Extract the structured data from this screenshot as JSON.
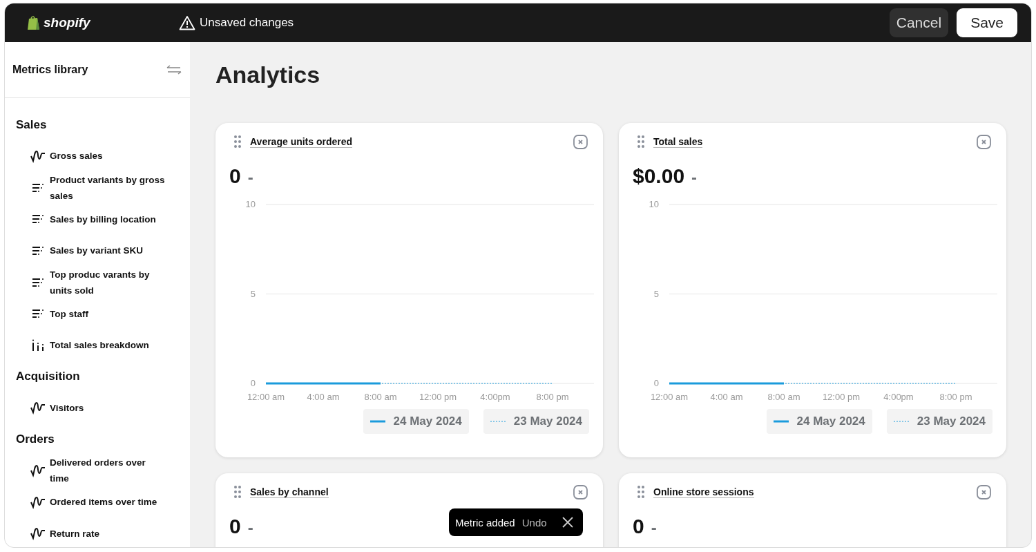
{
  "top_bar": {
    "logo": "shopify",
    "status": "Unsaved changes",
    "buttons": [
      {
        "label": "Cancel",
        "kind": "secondary"
      },
      {
        "label": "Save",
        "kind": "primary"
      }
    ]
  },
  "sidebar": {
    "title": "Metrics library",
    "sections": [
      {
        "title": "Sales",
        "items": [
          {
            "label": "Gross sales",
            "kind": "line"
          },
          {
            "label": "Product variants by gross sales",
            "kind": "bar"
          },
          {
            "label": "Sales by billing location",
            "kind": "bar"
          },
          {
            "label": "Sales by variant SKU",
            "kind": "bar"
          },
          {
            "label": "Top produc varants by units sold",
            "kind": "bar"
          },
          {
            "label": "Top staff",
            "kind": "bar"
          },
          {
            "label": "Total sales breakdown",
            "kind": "column"
          }
        ]
      },
      {
        "title": "Acquisition",
        "items": [
          {
            "label": "Visitors",
            "kind": "line"
          }
        ]
      },
      {
        "title": "Orders",
        "items": [
          {
            "label": "Delivered orders over time",
            "kind": "line"
          },
          {
            "label": "Ordered items over time",
            "kind": "line"
          },
          {
            "label": "Return rate",
            "kind": "line"
          }
        ]
      }
    ]
  },
  "page_title": "Analytics",
  "cards": [
    {
      "title": "Average units ordered",
      "value": "0",
      "change": "-",
      "chart_data": {
        "type": "line",
        "categories": [
          "12:00 am",
          "4:00 am",
          "8:00 am",
          "12:00 pm",
          "4:00pm",
          "8:00 pm"
        ],
        "yticks": [
          0,
          5,
          10
        ],
        "ylim": [
          0,
          10
        ],
        "series": [
          {
            "name": "24 May 2024",
            "color": "#1a9bdc",
            "line_style": "solid",
            "values": [
              0,
              0,
              0,
              null,
              null,
              null
            ]
          },
          {
            "name": "23 May 2024",
            "color": "#1a9bdc",
            "line_style": "dotted",
            "values": [
              0,
              0,
              0,
              0,
              0,
              0
            ]
          }
        ]
      }
    },
    {
      "title": "Total sales",
      "value": "$0.00",
      "change": "-",
      "chart_data": {
        "type": "line",
        "categories": [
          "12:00 am",
          "4:00 am",
          "8:00 am",
          "12:00 pm",
          "4:00pm",
          "8:00 pm"
        ],
        "yticks": [
          0,
          5,
          10
        ],
        "ylim": [
          0,
          10
        ],
        "series": [
          {
            "name": "24 May 2024",
            "color": "#1a9bdc",
            "line_style": "solid",
            "values": [
              0,
              0,
              0,
              null,
              null,
              null
            ]
          },
          {
            "name": "23 May 2024",
            "color": "#1a9bdc",
            "line_style": "dotted",
            "values": [
              0,
              0,
              0,
              0,
              0,
              0
            ]
          }
        ]
      }
    },
    {
      "title": "Sales by channel",
      "value": "0",
      "change": "-"
    },
    {
      "title": "Online store sessions",
      "value": "0",
      "change": "-"
    }
  ],
  "toast": {
    "message": "Metric added",
    "action": "Undo"
  }
}
